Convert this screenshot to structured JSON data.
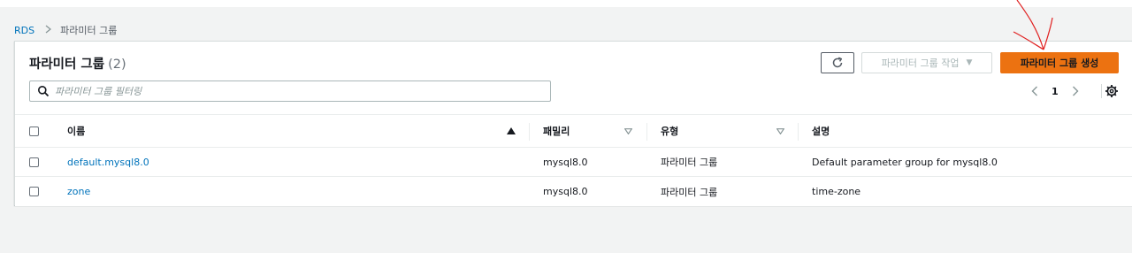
{
  "breadcrumb": {
    "root": "RDS",
    "current": "파라미터 그룹"
  },
  "panel": {
    "title": "파라미터 그룹",
    "count": "(2)"
  },
  "toolbar": {
    "actions_label": "파라미터 그룹 작업",
    "create_label": "파라미터 그룹 생성"
  },
  "search": {
    "placeholder": "파라미터 그룹 필터링",
    "value": ""
  },
  "pagination": {
    "current_page": "1"
  },
  "table": {
    "columns": {
      "name": "이름",
      "family": "패밀리",
      "type": "유형",
      "description": "설명"
    },
    "rows": [
      {
        "name": "default.mysql8.0",
        "family": "mysql8.0",
        "type": "파라미터 그룹",
        "description": "Default parameter group for mysql8.0"
      },
      {
        "name": "zone",
        "family": "mysql8.0",
        "type": "파라미터 그룹",
        "description": "time-zone"
      }
    ]
  },
  "colors": {
    "accent": "#ec7211",
    "link": "#0073bb",
    "annotation": "#e02020"
  },
  "icons": [
    "refresh-icon",
    "caret-down-icon",
    "search-icon",
    "chevron-left-icon",
    "chevron-right-icon",
    "settings-gear-icon",
    "sort-ascending-icon",
    "sort-descending-icon"
  ]
}
